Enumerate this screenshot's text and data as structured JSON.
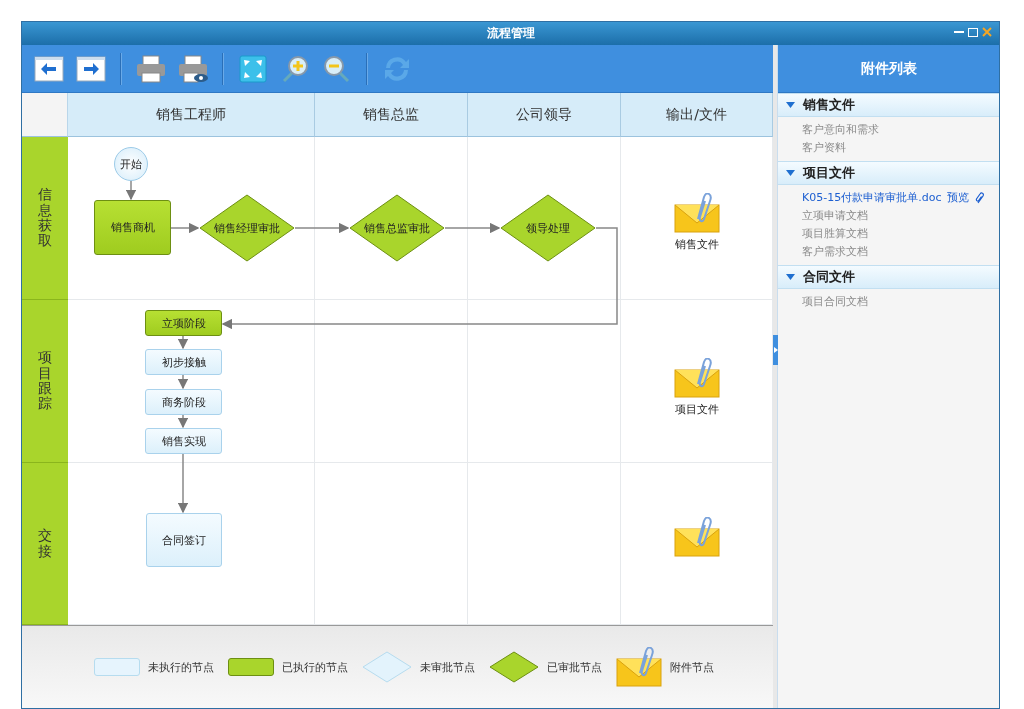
{
  "window": {
    "title": "流程管理"
  },
  "columns": [
    {
      "label": "销售工程师"
    },
    {
      "label": "销售总监"
    },
    {
      "label": "公司领导"
    },
    {
      "label": "输出/文件"
    }
  ],
  "lanes": [
    {
      "label": "信息获取"
    },
    {
      "label": "项目跟踪"
    },
    {
      "label": "交接"
    }
  ],
  "nodes": [
    {
      "kind": "start",
      "label": "开始"
    },
    {
      "kind": "task",
      "label": "销售商机",
      "executed": true
    },
    {
      "kind": "decision",
      "label": "销售经理审批",
      "approved": true
    },
    {
      "kind": "decision",
      "label": "销售总监审批",
      "approved": true
    },
    {
      "kind": "decision",
      "label": "领导处理",
      "approved": true
    },
    {
      "kind": "task",
      "label": "立项阶段",
      "executed": true
    },
    {
      "kind": "task",
      "label": "初步接触",
      "executed": false
    },
    {
      "kind": "task",
      "label": "商务阶段",
      "executed": false
    },
    {
      "kind": "task",
      "label": "销售实现",
      "executed": false
    },
    {
      "kind": "task",
      "label": "合同签订",
      "executed": false
    },
    {
      "kind": "attachment",
      "label": "销售文件"
    },
    {
      "kind": "attachment",
      "label": "项目文件"
    },
    {
      "kind": "attachment"
    }
  ],
  "attachments": {
    "title": "附件列表",
    "groups": [
      {
        "title": "销售文件",
        "expanded": true,
        "items": [
          {
            "text": "客户意向和需求"
          },
          {
            "text": "客户资料"
          }
        ]
      },
      {
        "title": "项目文件",
        "expanded": true,
        "items": [
          {
            "text": "K05-15付款申请审批单.doc",
            "kind": "file",
            "action": "预览"
          },
          {
            "text": "立项申请文档"
          },
          {
            "text": "项目胜算文档"
          },
          {
            "text": "客户需求文档"
          }
        ]
      },
      {
        "title": "合同文件",
        "expanded": true,
        "items": [
          {
            "text": "项目合同文档"
          }
        ]
      }
    ]
  },
  "legend": [
    {
      "kind": "task",
      "executed": false,
      "label": "未执行的节点"
    },
    {
      "kind": "task",
      "executed": true,
      "label": "已执行的节点"
    },
    {
      "kind": "decision",
      "approved": false,
      "label": "未审批节点"
    },
    {
      "kind": "decision",
      "approved": true,
      "label": "已审批节点"
    },
    {
      "kind": "attachment",
      "label": "附件节点"
    }
  ]
}
